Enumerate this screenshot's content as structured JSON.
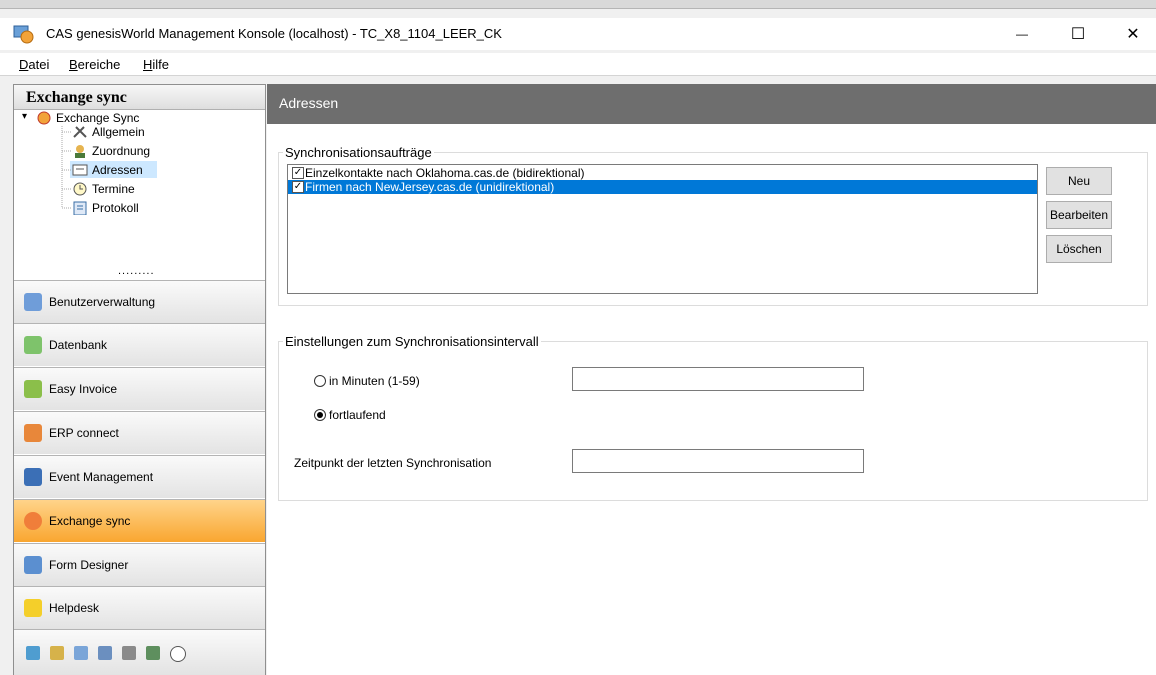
{
  "window": {
    "title": "CAS genesisWorld Management Konsole (localhost) - TC_X8_1104_LEER_CK",
    "minimize_glyph": "—",
    "maximize_glyph": "☐",
    "close_glyph": "✕"
  },
  "menu": [
    "Datei",
    "Bereiche",
    "Hilfe"
  ],
  "nav": {
    "header": "Exchange sync",
    "tree": {
      "root": "Exchange Sync",
      "children": [
        "Allgemein",
        "Zuordnung",
        "Adressen",
        "Termine",
        "Protokoll"
      ],
      "selected": "Adressen"
    },
    "grip": ".........",
    "buttons": [
      {
        "label": "Benutzerverwaltung",
        "icon": "users-icon"
      },
      {
        "label": "Datenbank",
        "icon": "database-icon"
      },
      {
        "label": "Easy Invoice",
        "icon": "invoice-icon"
      },
      {
        "label": "ERP connect",
        "icon": "erp-icon"
      },
      {
        "label": "Event Management",
        "icon": "event-icon"
      },
      {
        "label": "Exchange sync",
        "icon": "exchange-icon",
        "active": true
      },
      {
        "label": "Form Designer",
        "icon": "form-icon"
      },
      {
        "label": "Helpdesk",
        "icon": "helpdesk-icon"
      }
    ]
  },
  "page": {
    "title": "Adressen",
    "sync_group": {
      "legend": "Synchronisationsaufträge",
      "items": [
        {
          "label": "Einzelkontakte nach Oklahoma.cas.de (bidirektional)",
          "checked": true,
          "selected": false
        },
        {
          "label": "Firmen nach NewJersey.cas.de (unidirektional)",
          "checked": true,
          "selected": true
        }
      ],
      "buttons": {
        "new": "Neu",
        "edit": "Bearbeiten",
        "delete": "Löschen"
      }
    },
    "interval_group": {
      "legend": "Einstellungen zum Synchronisationsintervall",
      "option_minutes": "in Minuten (1-59)",
      "option_continuous": "fortlaufend",
      "selected_option": "fortlaufend",
      "minutes_value": "",
      "last_sync_label": "Zeitpunkt der letzten Synchronisation",
      "last_sync_value": ""
    }
  },
  "colors": {
    "accent": "#0078d7",
    "header_bg": "#6e6e6e",
    "active_nav": "#f9a630"
  }
}
